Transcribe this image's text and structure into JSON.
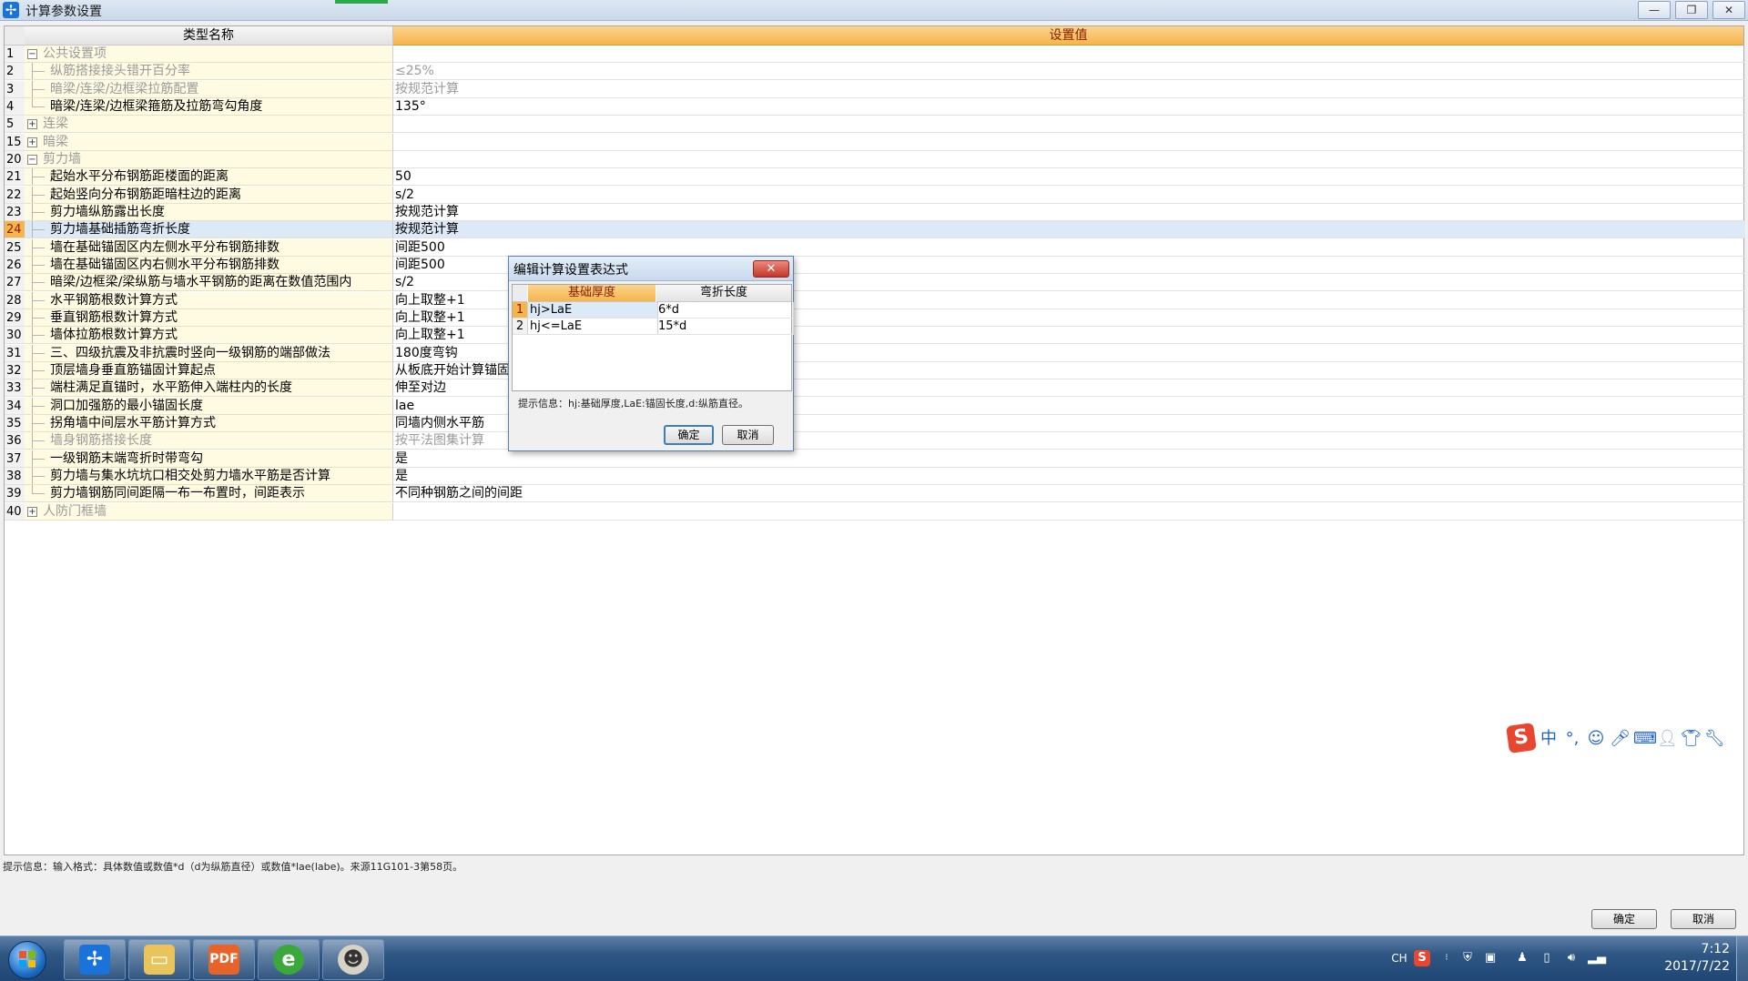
{
  "window": {
    "title": "计算参数设置",
    "minimize": "—",
    "restore": "❐",
    "close": "✕",
    "accent_color": "#2aa84a"
  },
  "grid": {
    "columns": [
      "类型名称",
      "设置值"
    ],
    "rows": [
      {
        "num": "1",
        "name": "公共设置项",
        "value": "",
        "type": "group",
        "toggle": "−",
        "muted": true
      },
      {
        "num": "2",
        "name": "纵筋搭接接头错开百分率",
        "value": "≤25%",
        "type": "item",
        "muted": true
      },
      {
        "num": "3",
        "name": "暗梁/连梁/边框梁拉筋配置",
        "value": "按规范计算",
        "type": "item",
        "muted": true
      },
      {
        "num": "4",
        "name": "暗梁/连梁/边框梁箍筋及拉筋弯勾角度",
        "value": "135°",
        "type": "item-last",
        "muted": false
      },
      {
        "num": "5",
        "name": "连梁",
        "value": "",
        "type": "group",
        "toggle": "+",
        "muted": true
      },
      {
        "num": "15",
        "name": "暗梁",
        "value": "",
        "type": "group",
        "toggle": "+",
        "muted": true
      },
      {
        "num": "20",
        "name": "剪力墙",
        "value": "",
        "type": "group",
        "toggle": "−",
        "muted": true
      },
      {
        "num": "21",
        "name": "起始水平分布钢筋距楼面的距离",
        "value": "50",
        "type": "item",
        "muted": false
      },
      {
        "num": "22",
        "name": "起始竖向分布钢筋距暗柱边的距离",
        "value": "s/2",
        "type": "item",
        "muted": false
      },
      {
        "num": "23",
        "name": "剪力墙纵筋露出长度",
        "value": "按规范计算",
        "type": "item",
        "muted": false
      },
      {
        "num": "24",
        "name": "剪力墙基础插筋弯折长度",
        "value": "按规范计算",
        "type": "item",
        "muted": false,
        "selected": true
      },
      {
        "num": "25",
        "name": "墙在基础锚固区内左侧水平分布钢筋排数",
        "value": "间距500",
        "type": "item",
        "muted": false
      },
      {
        "num": "26",
        "name": "墙在基础锚固区内右侧水平分布钢筋排数",
        "value": "间距500",
        "type": "item",
        "muted": false
      },
      {
        "num": "27",
        "name": "暗梁/边框梁/梁纵筋与墙水平钢筋的距离在数值范围内",
        "value": "s/2",
        "type": "item",
        "muted": false
      },
      {
        "num": "28",
        "name": "水平钢筋根数计算方式",
        "value": "向上取整+1",
        "type": "item",
        "muted": false
      },
      {
        "num": "29",
        "name": "垂直钢筋根数计算方式",
        "value": "向上取整+1",
        "type": "item",
        "muted": false
      },
      {
        "num": "30",
        "name": "墙体拉筋根数计算方式",
        "value": "向上取整+1",
        "type": "item",
        "muted": false
      },
      {
        "num": "31",
        "name": "三、四级抗震及非抗震时竖向一级钢筋的端部做法",
        "value": "180度弯钩",
        "type": "item",
        "muted": false
      },
      {
        "num": "32",
        "name": "顶层墙身垂直筋锚固计算起点",
        "value": "从板底开始计算锚固",
        "type": "item",
        "muted": false
      },
      {
        "num": "33",
        "name": "端柱满足直锚时，水平筋伸入端柱内的长度",
        "value": "伸至对边",
        "type": "item",
        "muted": false
      },
      {
        "num": "34",
        "name": "洞口加强筋的最小锚固长度",
        "value": "lae",
        "type": "item",
        "muted": false
      },
      {
        "num": "35",
        "name": "拐角墙中间层水平筋计算方式",
        "value": "同墙内侧水平筋",
        "type": "item",
        "muted": false
      },
      {
        "num": "36",
        "name": "墙身钢筋搭接长度",
        "value": "按平法图集计算",
        "type": "item",
        "muted": true
      },
      {
        "num": "37",
        "name": "一级钢筋末端弯折时带弯勾",
        "value": "是",
        "type": "item",
        "muted": false
      },
      {
        "num": "38",
        "name": "剪力墙与集水坑坑口相交处剪力墙水平筋是否计算",
        "value": "是",
        "type": "item",
        "muted": false
      },
      {
        "num": "39",
        "name": "剪力墙钢筋同间距隔一布一布置时，间距表示",
        "value": "不同种钢筋之间的间距",
        "type": "item-last",
        "muted": false
      },
      {
        "num": "40",
        "name": "人防门框墙",
        "value": "",
        "type": "group",
        "toggle": "+",
        "muted": true
      }
    ]
  },
  "dialog": {
    "title": "编辑计算设置表达式",
    "close": "✕",
    "columns": [
      "基础厚度",
      "弯折长度"
    ],
    "rows": [
      {
        "num": "1",
        "c1": "hj>LaE",
        "c2": "6*d"
      },
      {
        "num": "2",
        "c1": "hj<=LaE",
        "c2": "15*d"
      }
    ],
    "hint": "提示信息：hj:基础厚度,LaE:锚固长度,d:纵筋直径。",
    "ok": "确定",
    "cancel": "取消"
  },
  "status": {
    "hint": "提示信息：输入格式：具体数值或数值*d（d为纵筋直径）或数值*lae(labe)。来源11G101-3第58页。",
    "ok": "确定",
    "cancel": "取消"
  },
  "ime": {
    "logo": "S",
    "lang": "中",
    "punct": "°,"
  },
  "taskbar": {
    "lang": "CH",
    "time": "7:12",
    "date": "2017/7/22"
  }
}
